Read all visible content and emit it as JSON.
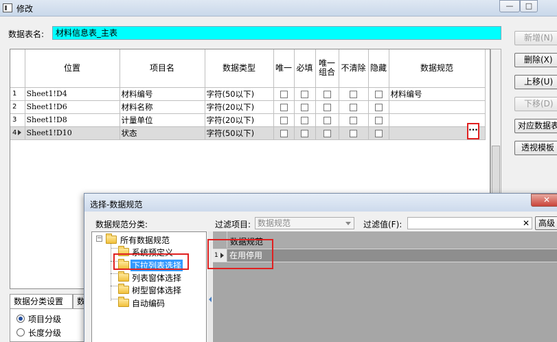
{
  "window": {
    "title": "修改",
    "btn_min": "—",
    "btn_max": "□"
  },
  "table_name": {
    "label": "数据表名:",
    "value": "材料信息表_主表"
  },
  "grid": {
    "headers": [
      "位置",
      "项目名",
      "数据类型",
      "唯一",
      "必填",
      "唯一组合",
      "不清除",
      "隐藏",
      "数据规范"
    ],
    "rows": [
      {
        "num": "1",
        "pos": "Sheet1!D4",
        "name": "材料编号",
        "type": "字符(50以下)",
        "spec": "材料编号"
      },
      {
        "num": "2",
        "pos": "Sheet1!D6",
        "name": "材料名称",
        "type": "字符(20以下)",
        "spec": ""
      },
      {
        "num": "3",
        "pos": "Sheet1!D8",
        "name": "计量单位",
        "type": "字符(20以下)",
        "spec": ""
      },
      {
        "num": "4",
        "pos": "Sheet1!D10",
        "name": "状态",
        "type": "字符(50以下)",
        "spec": ""
      }
    ],
    "ellipsis": "···"
  },
  "buttons": {
    "add": "新增(N)",
    "delete": "删除(X)",
    "up": "上移(U)",
    "down": "下移(D)",
    "map": "对应数据表",
    "pivot": "透视模板"
  },
  "tabs": {
    "tab1": "数据分类设置",
    "tab2": "数据"
  },
  "radios": {
    "r1": "项目分级",
    "r2": "长度分级"
  },
  "dialog": {
    "title": "选择-数据规范",
    "close": "✕",
    "category_label": "数据规范分类:",
    "filter_item_label": "过滤项目:",
    "filter_item_value": "数据规范",
    "filter_value_label": "过滤值(F):",
    "filter_clear": "✕",
    "advanced": "高级",
    "tree": {
      "root": "所有数据规范",
      "children": [
        "系统预定义",
        "下拉列表选择",
        "列表窗体选择",
        "树型窗体选择",
        "自动编码"
      ]
    },
    "result_header": "数据规范",
    "result_row_num": "1",
    "result_row": "在用停用"
  }
}
